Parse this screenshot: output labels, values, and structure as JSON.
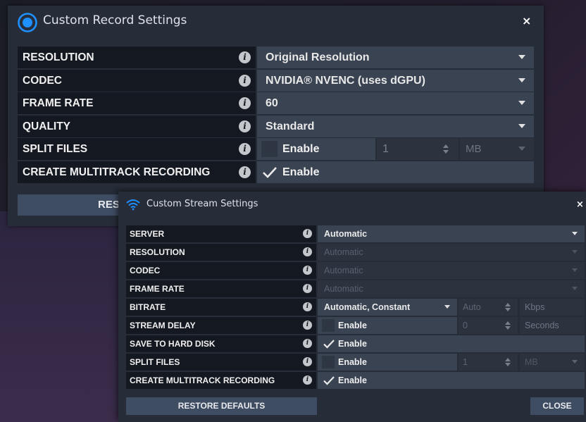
{
  "record": {
    "title": "Custom Record Settings",
    "close_glyph": "×",
    "info_glyph": "i",
    "rows": [
      {
        "label": "RESOLUTION",
        "value": "Original Resolution"
      },
      {
        "label": "CODEC",
        "value": "NVIDIA® NVENC (uses dGPU)"
      },
      {
        "label": "FRAME RATE",
        "value": "60"
      },
      {
        "label": "QUALITY",
        "value": "Standard"
      },
      {
        "label": "SPLIT FILES",
        "enable": "Enable",
        "number": "1",
        "unit": "MB"
      },
      {
        "label": "CREATE MULTITRACK RECORDING",
        "enable": "Enable"
      }
    ],
    "restore_label": "RESTORE DEFAULTS",
    "accent": "#1e90ff"
  },
  "stream": {
    "title": "Custom Stream Settings",
    "close_glyph": "×",
    "info_glyph": "i",
    "rows": [
      {
        "label": "SERVER",
        "value": "Automatic"
      },
      {
        "label": "RESOLUTION",
        "value": "Automatic"
      },
      {
        "label": "CODEC",
        "value": "Automatic"
      },
      {
        "label": "FRAME RATE",
        "value": "Automatic"
      },
      {
        "label": "BITRATE",
        "value": "Automatic, Constant",
        "number": "Auto",
        "unit": "Kbps"
      },
      {
        "label": "STREAM DELAY",
        "enable": "Enable",
        "number": "0",
        "unit": "Seconds"
      },
      {
        "label": "SAVE TO HARD DISK",
        "enable": "Enable"
      },
      {
        "label": "SPLIT FILES",
        "enable": "Enable",
        "number": "1",
        "unit": "MB"
      },
      {
        "label": "CREATE MULTITRACK RECORDING",
        "enable": "Enable"
      }
    ],
    "restore_label": "RESTORE DEFAULTS",
    "close_label": "CLOSE",
    "accent": "#1e90ff"
  }
}
